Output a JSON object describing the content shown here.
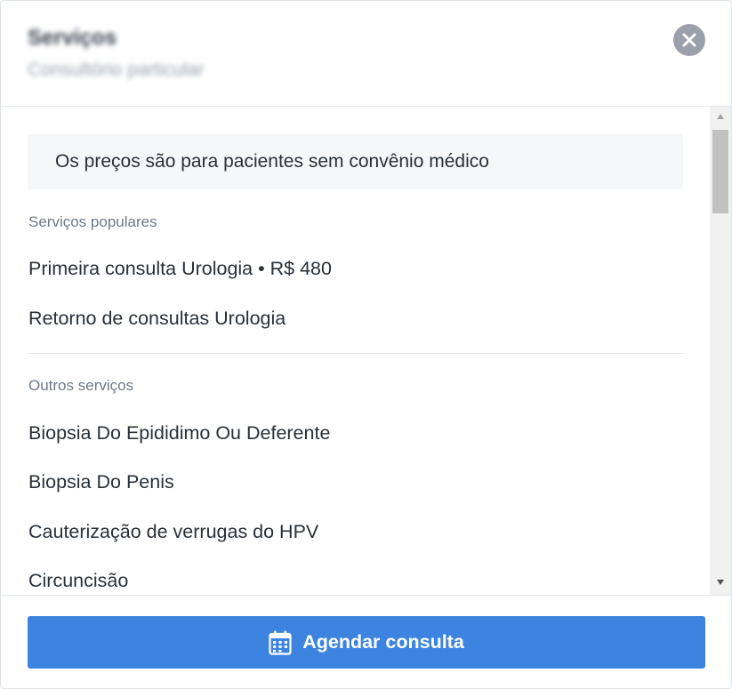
{
  "header": {
    "title": "Serviços",
    "subtitle": "Consultório particular"
  },
  "notice": "Os preços são para pacientes sem convênio médico",
  "popular": {
    "label": "Serviços populares",
    "items": [
      "Primeira consulta Urologia • R$ 480",
      "Retorno de consultas Urologia"
    ]
  },
  "other": {
    "label": "Outros serviços",
    "items": [
      "Biopsia Do Epididimo Ou Deferente",
      "Biopsia Do Penis",
      "Cauterização de verrugas do HPV",
      "Circuncisão"
    ]
  },
  "footer": {
    "book_label": "Agendar consulta",
    "book_icon": "calendar-icon"
  },
  "colors": {
    "primary_button": "#3d84e0",
    "close_button": "#9aa1ab",
    "notice_background": "#f6f7f9"
  }
}
